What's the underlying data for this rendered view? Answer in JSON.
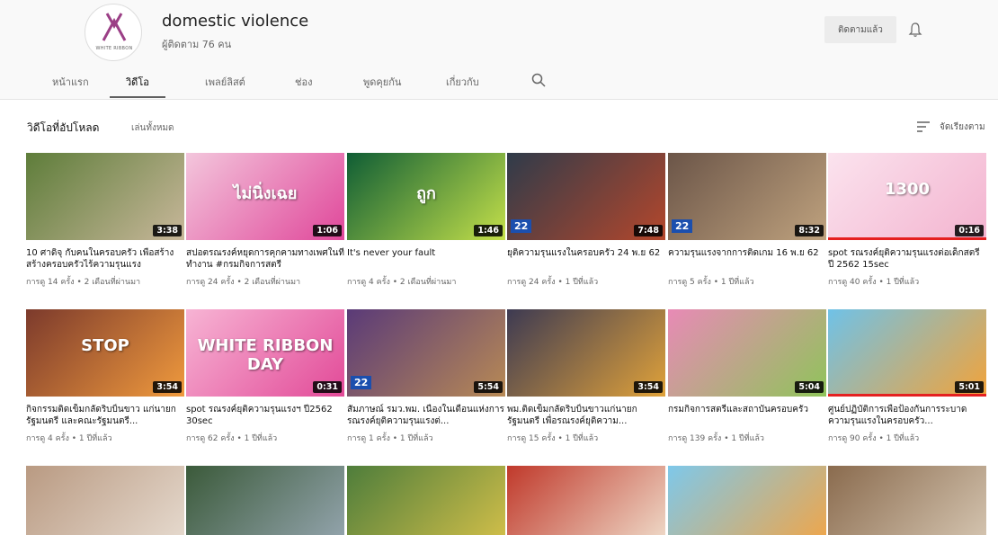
{
  "channel": {
    "logo_text": "WHITE RIBBON",
    "name": "domestic violence",
    "subscribers": "ผู้ติดตาม 76 คน",
    "subscribe_label": "ติดตามแล้ว",
    "bell_icon": "bell-icon"
  },
  "tabs": [
    {
      "label": "หน้าแรก"
    },
    {
      "label": "วิดีโอ",
      "active": true
    },
    {
      "label": "เพลย์ลิสต์"
    },
    {
      "label": "ช่อง"
    },
    {
      "label": "พูดคุยกัน"
    },
    {
      "label": "เกี่ยวกับ"
    }
  ],
  "search_icon": "search-icon",
  "section": {
    "title": "วิดีโอที่อัปโหลด",
    "play_all": "เล่นทั้งหมด",
    "sort_label": "จัดเรียงตาม",
    "sort_icon": "sort-icon"
  },
  "videos": [
    {
      "title": "10 ศาดิจุ กับคนในครอบครัว เพื่อสร้างสร้างครอบครัวไร้ความรุนแรง",
      "meta": "การดู 14 ครั้ง • 2 เดือนที่ผ่านมา",
      "duration": "3:38",
      "colors": [
        "#5e7d3a",
        "#c8b79a"
      ],
      "progress": 0
    },
    {
      "title": "สปอตรณรงค์หยุดการคุกคามทางเพศในที่ทำงาน #กรมกิจการสตรี",
      "meta": "การดู 24 ครั้ง • 2 เดือนที่ผ่านมา",
      "duration": "1:06",
      "colors": [
        "#f3c6dc",
        "#e0479a"
      ],
      "overlay": "ไม่นิ่งเฉย",
      "progress": 0
    },
    {
      "title": "It's never your fault",
      "meta": "การดู 4 ครั้ง • 2 เดือนที่ผ่านมา",
      "duration": "1:46",
      "colors": [
        "#0f5d35",
        "#c4e04a"
      ],
      "overlay": "ถูก",
      "progress": 0
    },
    {
      "title": "ยุติความรุนแรงในครอบครัว 24 พ.ย 62",
      "meta": "การดู 24 ครั้ง • 1 ปีที่แล้ว",
      "duration": "7:48",
      "colors": [
        "#2f3b4a",
        "#b4472c"
      ],
      "badge": "22",
      "progress": 0
    },
    {
      "title": "ความรุนแรงจากการติดเกม 16 พ.ย 62",
      "meta": "การดู 5 ครั้ง • 1 ปีที่แล้ว",
      "duration": "8:32",
      "colors": [
        "#6b5548",
        "#bfa27e"
      ],
      "badge": "22",
      "progress": 0
    },
    {
      "title": "spot รณรงค์ยุติความรุนแรงต่อเด็กสตรี ปี 2562 15sec",
      "meta": "การดู 40 ครั้ง • 1 ปีที่แล้ว",
      "duration": "0:16",
      "colors": [
        "#fbe3ee",
        "#f3b3cf"
      ],
      "overlay": "1300",
      "progress": 100
    },
    {
      "title": "กิจกรรมติดเข็มกลัดริบบิ้นขาว แก่นายกรัฐมนตรี และคณะรัฐมนตรี...",
      "meta": "การดู 4 ครั้ง • 1 ปีที่แล้ว",
      "duration": "3:54",
      "colors": [
        "#7c3a2c",
        "#f09a3d"
      ],
      "overlay": "STOP",
      "progress": 0
    },
    {
      "title": "spot รณรงค์ยุติความรุนแรงฯ ปี2562 30sec",
      "meta": "การดู 62 ครั้ง • 1 ปีที่แล้ว",
      "duration": "0:31",
      "colors": [
        "#f7b4d4",
        "#e24a98"
      ],
      "overlay": "WHITE RIBBON DAY",
      "progress": 0
    },
    {
      "title": "สัมภาษณ์ รมว.พม. เนื่องในเดือนแห่งการรณรงค์ยุติความรุนแรงต่...",
      "meta": "การดู 1 ครั้ง • 1 ปีที่แล้ว",
      "duration": "5:54",
      "colors": [
        "#5a3a78",
        "#b88a55"
      ],
      "badge": "22",
      "progress": 0
    },
    {
      "title": "พม.ติดเข็มกลัดริบบิ้นขาวแก่นายกรัฐมนตรี เพื่อรณรงค์ยุติความ...",
      "meta": "การดู 15 ครั้ง • 1 ปีที่แล้ว",
      "duration": "3:54",
      "colors": [
        "#3d3a52",
        "#e0a23a"
      ],
      "progress": 0
    },
    {
      "title": "กรมกิจการสตรีและสถาบันครอบครัว",
      "meta": "การดู 139 ครั้ง • 1 ปีที่แล้ว",
      "duration": "5:04",
      "colors": [
        "#e88ab6",
        "#8fc45a"
      ],
      "progress": 0
    },
    {
      "title": "ศูนย์ปฏิบัติการเพื่อป้องกันการระบาดความรุนแรงในครอบครัว...",
      "meta": "การดู 90 ครั้ง • 1 ปีที่แล้ว",
      "duration": "5:01",
      "colors": [
        "#6fc2e8",
        "#f2a33a"
      ],
      "progress": 100
    },
    {
      "title": "",
      "meta": "",
      "duration": "",
      "colors": [
        "#b99a82",
        "#e8ddd2"
      ],
      "progress": 0
    },
    {
      "title": "",
      "meta": "",
      "duration": "",
      "colors": [
        "#3b5a3a",
        "#98a8b3"
      ],
      "progress": 0
    },
    {
      "title": "",
      "meta": "",
      "duration": "",
      "colors": [
        "#4e7d3b",
        "#d8c24a"
      ],
      "progress": 0
    },
    {
      "title": "",
      "meta": "",
      "duration": "",
      "colors": [
        "#c0392b",
        "#f1e2d0"
      ],
      "progress": 0
    },
    {
      "title": "",
      "meta": "",
      "duration": "",
      "colors": [
        "#7ec8ea",
        "#f5a442"
      ],
      "progress": 0
    },
    {
      "title": "",
      "meta": "",
      "duration": "",
      "colors": [
        "#8a6b4e",
        "#d8c9b5"
      ],
      "progress": 0
    }
  ]
}
